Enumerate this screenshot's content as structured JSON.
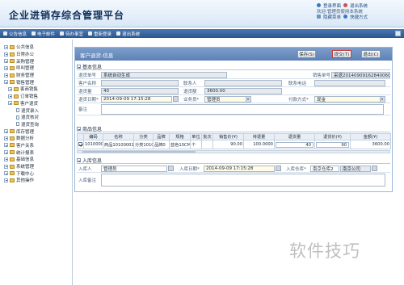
{
  "app": {
    "title": "企业进销存综合管理平台"
  },
  "header": {
    "links": [
      "登录界面",
      "退出系统"
    ],
    "welcome": "欢迎:管理员使用本系统",
    "options": [
      "隐藏菜单",
      "快捷方式"
    ]
  },
  "menubar": {
    "items": [
      "公告信息",
      "电子邮件",
      "待办事宜",
      "重新登录",
      "退出系统"
    ]
  },
  "sidebar": {
    "items": [
      {
        "label": "公共信息",
        "level": 1,
        "kind": "expand"
      },
      {
        "label": "日常办公",
        "level": 1,
        "kind": "expand"
      },
      {
        "label": "采购管理",
        "level": 1,
        "kind": "expand"
      },
      {
        "label": "呼叫管理",
        "level": 1,
        "kind": "expand"
      },
      {
        "label": "财务管理",
        "level": 1,
        "kind": "expand"
      },
      {
        "label": "销售管理",
        "level": 1,
        "kind": "expand"
      },
      {
        "label": "客商销售",
        "level": 2,
        "kind": "folder"
      },
      {
        "label": "订单销售",
        "level": 2,
        "kind": "folder"
      },
      {
        "label": "客户退货",
        "level": 2,
        "kind": "folder"
      },
      {
        "label": "退货录入",
        "level": 3,
        "kind": "doc"
      },
      {
        "label": "退货核对",
        "level": 3,
        "kind": "doc"
      },
      {
        "label": "退货查询",
        "level": 3,
        "kind": "doc"
      },
      {
        "label": "库存管理",
        "level": 1,
        "kind": "expand"
      },
      {
        "label": "数据分析",
        "level": 1,
        "kind": "expand"
      },
      {
        "label": "客户关系",
        "level": 1,
        "kind": "expand"
      },
      {
        "label": "统计报表",
        "level": 1,
        "kind": "expand"
      },
      {
        "label": "基础信息",
        "level": 1,
        "kind": "expand"
      },
      {
        "label": "系统管理",
        "level": 1,
        "kind": "expand"
      },
      {
        "label": "下载中心",
        "level": 1,
        "kind": "expand"
      },
      {
        "label": "其他操作",
        "level": 1,
        "kind": "expand"
      }
    ]
  },
  "content": {
    "title": "客户退货-信息",
    "buttons": {
      "save": "保存(S)",
      "submit": "提交(T)",
      "back": "退出(C)"
    },
    "basic": {
      "section": "基本信息",
      "return_no_label": "退货单号",
      "return_no": "系统自动生成",
      "sales_no_label": "销售单号",
      "sales_no": "采退20140909162840060",
      "client_label": "客户名称",
      "client": "",
      "contact_label": "联系人",
      "contact": "",
      "phone_label": "联系电话",
      "phone": "",
      "qty_label": "退货量",
      "qty": "40",
      "amount_label": "退货额",
      "amount": "3600.00",
      "date_label": "退货日期*",
      "date": "2014-09-09 17:15:28",
      "clerk_label": "业务员*",
      "clerk": "管理员",
      "pay_label": "付款方式*",
      "pay": "现金",
      "remark_label": "备注",
      "remark": ""
    },
    "products": {
      "section": "商品信息",
      "columns": [
        "编码",
        "名称",
        "分类",
        "品牌",
        "规格",
        "单位",
        "批次",
        "销售价(¥)",
        "待退量",
        "退货量",
        "退货价(¥)",
        "金额(¥)"
      ],
      "rows": [
        {
          "checked": true,
          "code": "10100001",
          "name": "商品10100001",
          "category": "分类1010",
          "brand": "品牌0",
          "spec": "蓝色10CM",
          "unit": "个",
          "batch": "",
          "sale_price": "90.00",
          "pending": "100.0000",
          "qty": "40",
          "price": "90",
          "total": "3600.00"
        }
      ]
    },
    "stock": {
      "section": "入库信息",
      "inbound_by_label": "入库人",
      "inbound_by": "管理员",
      "inbound_date_label": "入库日期*",
      "inbound_date": "2014-09-09 17:15:28",
      "warehouse_label": "入库仓库*",
      "warehouse": "南京仓库2",
      "company": "南京公司",
      "remark_label": "入库备注",
      "remark": ""
    }
  },
  "watermark": "软件技巧"
}
